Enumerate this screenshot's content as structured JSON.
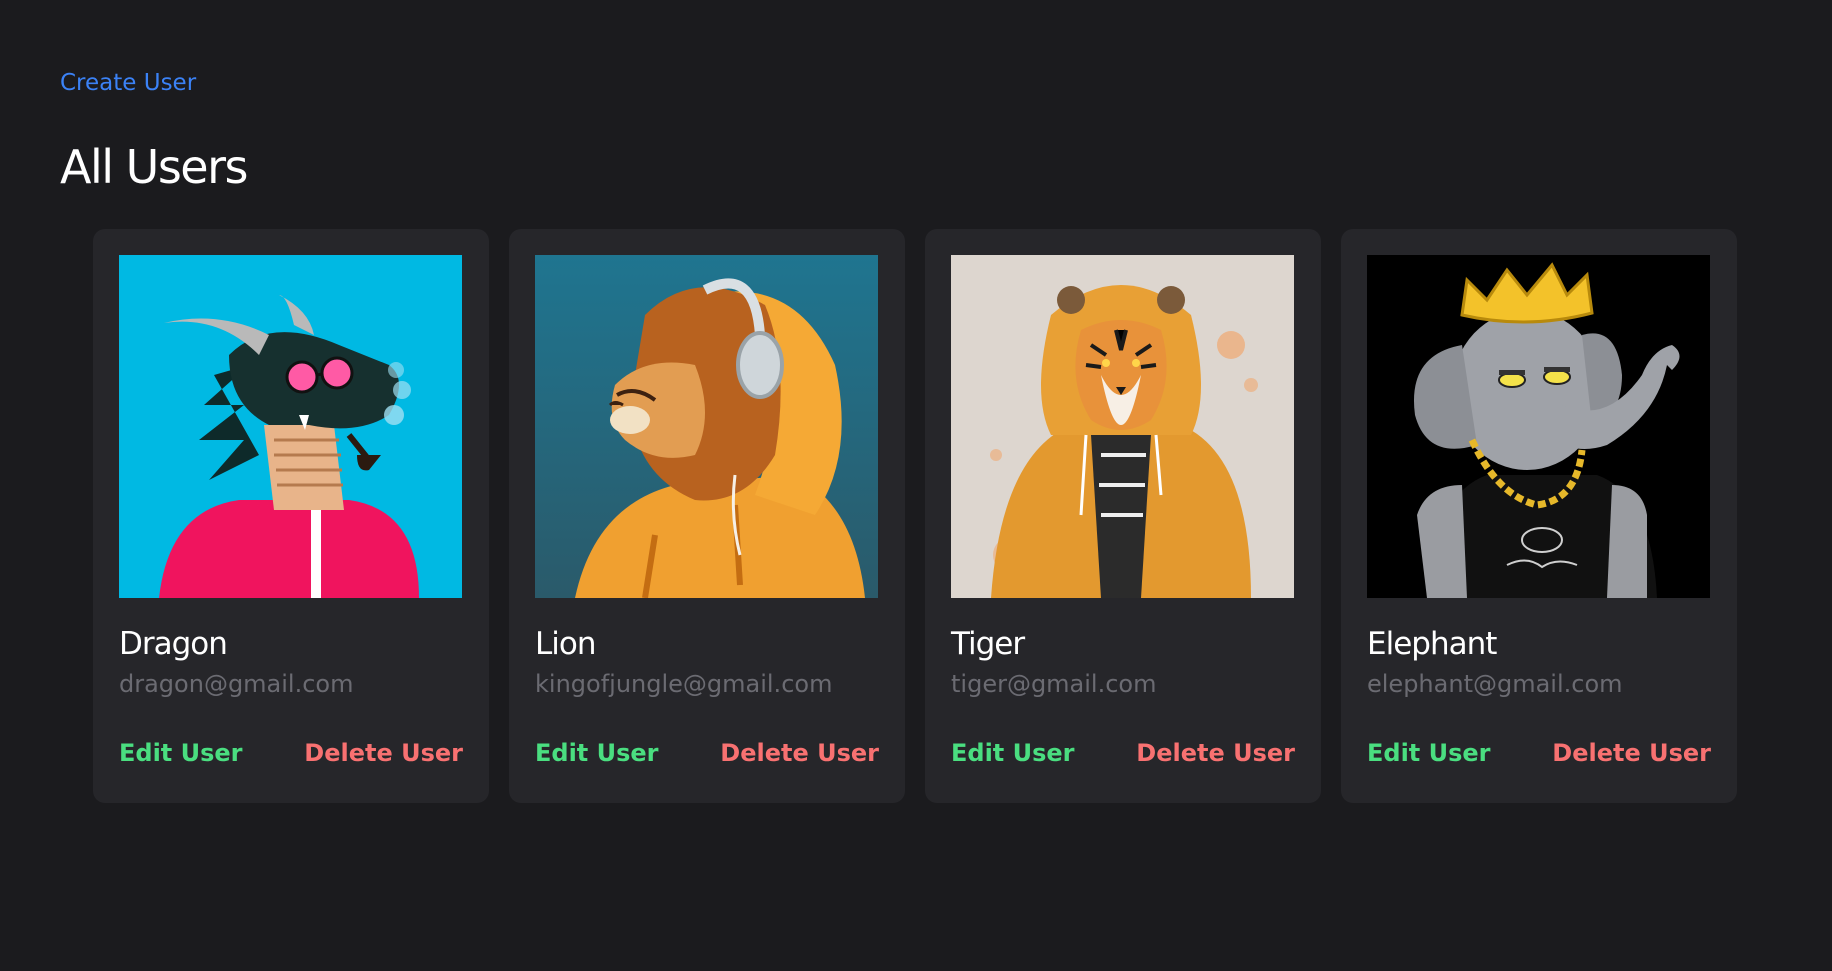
{
  "header": {
    "create_link_label": "Create User",
    "page_title": "All Users"
  },
  "users": [
    {
      "name": "Dragon",
      "email": "dragon@gmail.com",
      "edit_label": "Edit User",
      "delete_label": "Delete User",
      "avatar_icon": "dragon-avatar",
      "avatar_bg": "#00b9e3"
    },
    {
      "name": "Lion",
      "email": "kingofjungle@gmail.com",
      "edit_label": "Edit User",
      "delete_label": "Delete User",
      "avatar_icon": "lion-avatar",
      "avatar_bg": "#1f6f86"
    },
    {
      "name": "Tiger",
      "email": "tiger@gmail.com",
      "edit_label": "Edit User",
      "delete_label": "Delete User",
      "avatar_icon": "tiger-avatar",
      "avatar_bg": "#ddd6cf"
    },
    {
      "name": "Elephant",
      "email": "elephant@gmail.com",
      "edit_label": "Edit User",
      "delete_label": "Delete User",
      "avatar_icon": "elephant-avatar",
      "avatar_bg": "#000000"
    }
  ],
  "colors": {
    "background": "#1b1b1e",
    "card": "#26262a",
    "link": "#3b82f6",
    "edit": "#4ade80",
    "delete": "#f87171",
    "email": "#6b6b72"
  }
}
